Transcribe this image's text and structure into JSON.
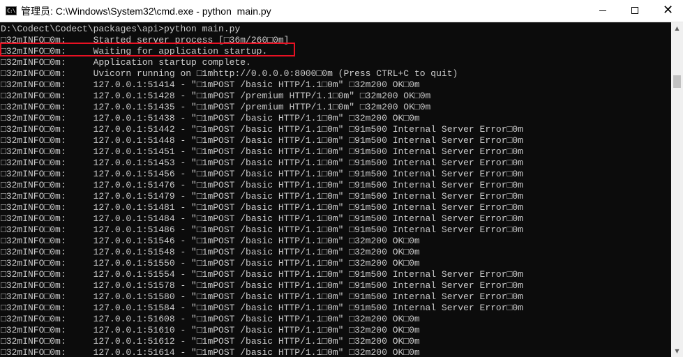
{
  "window": {
    "title": "管理员: C:\\Windows\\System32\\cmd.exe - python  main.py",
    "icon_glyph": "C:\\",
    "icon": "cmd-icon",
    "buttons": {
      "minimize": "minimize-icon",
      "maximize": "maximize-icon",
      "close": "close-icon"
    }
  },
  "console": {
    "background": "#0c0c0c",
    "foreground": "#cccccc",
    "highlight_color": "#e81123",
    "lines": [
      "D:\\Codect\\Codect\\packages\\api>python main.py",
      "□32mINFO□0m:     Started server process [□36m/260□0m]",
      "□32mINFO□0m:     Waiting for application startup.",
      "□32mINFO□0m:     Application startup complete.",
      "□32mINFO□0m:     Uvicorn running on □1mhttp://0.0.0.0:8000□0m (Press CTRL+C to quit)",
      "□32mINFO□0m:     127.0.0.1:51414 - \"□1mPOST /basic HTTP/1.1□0m\" □32m200 OK□0m",
      "□32mINFO□0m:     127.0.0.1:51428 - \"□1mPOST /premium HTTP/1.1□0m\" □32m200 OK□0m",
      "□32mINFO□0m:     127.0.0.1:51435 - \"□1mPOST /premium HTTP/1.1□0m\" □32m200 OK□0m",
      "□32mINFO□0m:     127.0.0.1:51438 - \"□1mPOST /basic HTTP/1.1□0m\" □32m200 OK□0m",
      "□32mINFO□0m:     127.0.0.1:51442 - \"□1mPOST /basic HTTP/1.1□0m\" □91m500 Internal Server Error□0m",
      "□32mINFO□0m:     127.0.0.1:51448 - \"□1mPOST /basic HTTP/1.1□0m\" □91m500 Internal Server Error□0m",
      "□32mINFO□0m:     127.0.0.1:51451 - \"□1mPOST /basic HTTP/1.1□0m\" □91m500 Internal Server Error□0m",
      "□32mINFO□0m:     127.0.0.1:51453 - \"□1mPOST /basic HTTP/1.1□0m\" □91m500 Internal Server Error□0m",
      "□32mINFO□0m:     127.0.0.1:51456 - \"□1mPOST /basic HTTP/1.1□0m\" □91m500 Internal Server Error□0m",
      "□32mINFO□0m:     127.0.0.1:51476 - \"□1mPOST /basic HTTP/1.1□0m\" □91m500 Internal Server Error□0m",
      "□32mINFO□0m:     127.0.0.1:51479 - \"□1mPOST /basic HTTP/1.1□0m\" □91m500 Internal Server Error□0m",
      "□32mINFO□0m:     127.0.0.1:51481 - \"□1mPOST /basic HTTP/1.1□0m\" □91m500 Internal Server Error□0m",
      "□32mINFO□0m:     127.0.0.1:51484 - \"□1mPOST /basic HTTP/1.1□0m\" □91m500 Internal Server Error□0m",
      "□32mINFO□0m:     127.0.0.1:51486 - \"□1mPOST /basic HTTP/1.1□0m\" □91m500 Internal Server Error□0m",
      "□32mINFO□0m:     127.0.0.1:51546 - \"□1mPOST /basic HTTP/1.1□0m\" □32m200 OK□0m",
      "□32mINFO□0m:     127.0.0.1:51548 - \"□1mPOST /basic HTTP/1.1□0m\" □32m200 OK□0m",
      "□32mINFO□0m:     127.0.0.1:51550 - \"□1mPOST /basic HTTP/1.1□0m\" □32m200 OK□0m",
      "□32mINFO□0m:     127.0.0.1:51554 - \"□1mPOST /basic HTTP/1.1□0m\" □91m500 Internal Server Error□0m",
      "□32mINFO□0m:     127.0.0.1:51578 - \"□1mPOST /basic HTTP/1.1□0m\" □91m500 Internal Server Error□0m",
      "□32mINFO□0m:     127.0.0.1:51580 - \"□1mPOST /basic HTTP/1.1□0m\" □91m500 Internal Server Error□0m",
      "□32mINFO□0m:     127.0.0.1:51584 - \"□1mPOST /basic HTTP/1.1□0m\" □91m500 Internal Server Error□0m",
      "□32mINFO□0m:     127.0.0.1:51608 - \"□1mPOST /basic HTTP/1.1□0m\" □32m200 OK□0m",
      "□32mINFO□0m:     127.0.0.1:51610 - \"□1mPOST /basic HTTP/1.1□0m\" □32m200 OK□0m",
      "□32mINFO□0m:     127.0.0.1:51612 - \"□1mPOST /basic HTTP/1.1□0m\" □32m200 OK□0m",
      "□32mINFO□0m:     127.0.0.1:51614 - \"□1mPOST /basic HTTP/1.1□0m\" □32m200 OK□0m"
    ]
  },
  "scrollbar": {
    "up": "scroll-up-arrow-icon",
    "down": "scroll-down-arrow-icon"
  }
}
